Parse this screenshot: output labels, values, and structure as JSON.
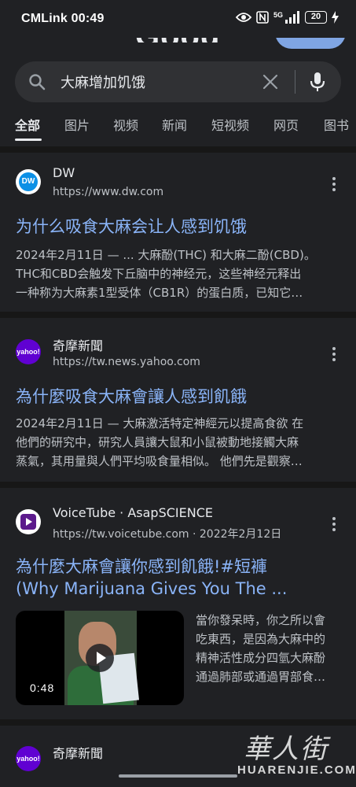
{
  "status_bar": {
    "carrier_time": "CMLink 00:49",
    "network": "5G",
    "battery": "20"
  },
  "search": {
    "query": "大麻增加饥饿"
  },
  "tabs": [
    "全部",
    "图片",
    "视频",
    "新闻",
    "短视频",
    "网页",
    "图书"
  ],
  "results": [
    {
      "site": "DW",
      "icon_text": "DW",
      "url": "https://www.dw.com",
      "title": "为什么吸食大麻会让人感到饥饿",
      "snippet": [
        "2024年2月11日 — ... 大麻酚(THC) 和大麻二酚(CBD)。",
        "THC和CBD会触发下丘脑中的神经元，这些神经元释出",
        "一种称为大麻素1型受体（CB1R）的蛋白质，已知它…"
      ]
    },
    {
      "site": "奇摩新聞",
      "icon_text": "yahoo!",
      "url": "https://tw.news.yahoo.com",
      "title": "為什麼吸食大麻會讓人感到飢餓",
      "snippet": [
        "2024年2月11日 — 大麻激活特定神經元以提高食欲 在",
        "他們的研究中，研究人員讓大鼠和小鼠被動地接觸大麻",
        "蒸氣，其用量與人們平均吸食量相似。 他們先是觀察…"
      ]
    },
    {
      "site": "VoiceTube · AsapSCIENCE",
      "url": "https://tw.voicetube.com · 2022年2月12日",
      "title_line1": "為什麼大麻會讓你感到飢餓!#短褲",
      "title_line2": "(Why Marijuana Gives You The ...",
      "duration": "0:48",
      "snippet": [
        "當你發呆時，你之所以會",
        "吃東西，是因為大麻中的",
        "精神活性成分四氫大麻酚",
        "通過肺部或通過胃部食…"
      ]
    },
    {
      "site": "奇摩新聞",
      "icon_text": "yahoo!"
    }
  ],
  "watermark": {
    "chinese": "華人街",
    "english": "HUARENJIE.COM"
  },
  "colors": {
    "background": "#202124",
    "link": "#8ab4f8",
    "yahoo_purple": "#6001d2",
    "dw_blue": "#0c90e6"
  }
}
